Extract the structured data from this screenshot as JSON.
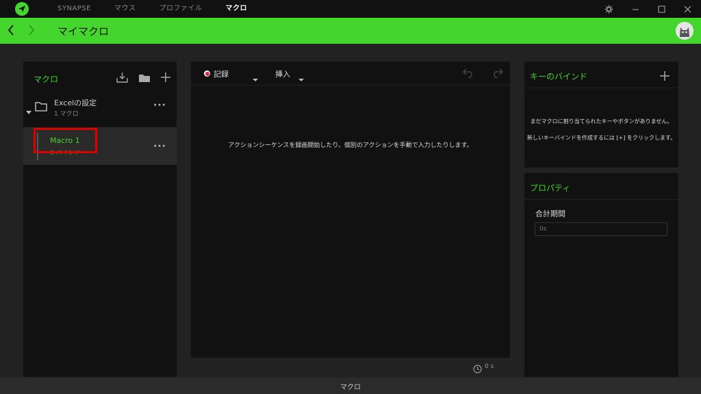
{
  "topnav": {
    "items": [
      "SYNAPSE",
      "マウス",
      "プロファイル",
      "マクロ"
    ],
    "active_index": 3
  },
  "header": {
    "title": "マイマクロ"
  },
  "macro_list": {
    "title": "マクロ",
    "folder": {
      "name": "Excelの設定",
      "count": "1 マクロ"
    },
    "macro": {
      "name": "Macro 1",
      "sub": "0 バインド"
    }
  },
  "editor": {
    "record_label": "記録",
    "insert_label": "挿入",
    "empty_message": "アクションシーケンスを録画開始したり、個別のアクションを手動で入力したりします。",
    "duration": "0 s"
  },
  "keybind": {
    "title": "キーのバインド",
    "message_line1": "まだマクロに割り当てられたキーやボタンがありません。",
    "message_line2": "新しいキーバインドを作成するには [+] をクリックします。"
  },
  "properties": {
    "title": "プロパティ",
    "total_label": "合計期間",
    "total_placeholder": "0s"
  },
  "statusbar": {
    "label": "マクロ"
  },
  "colors": {
    "accent": "#44d62c",
    "record": "#e8203a",
    "highlight": "#e00000"
  }
}
